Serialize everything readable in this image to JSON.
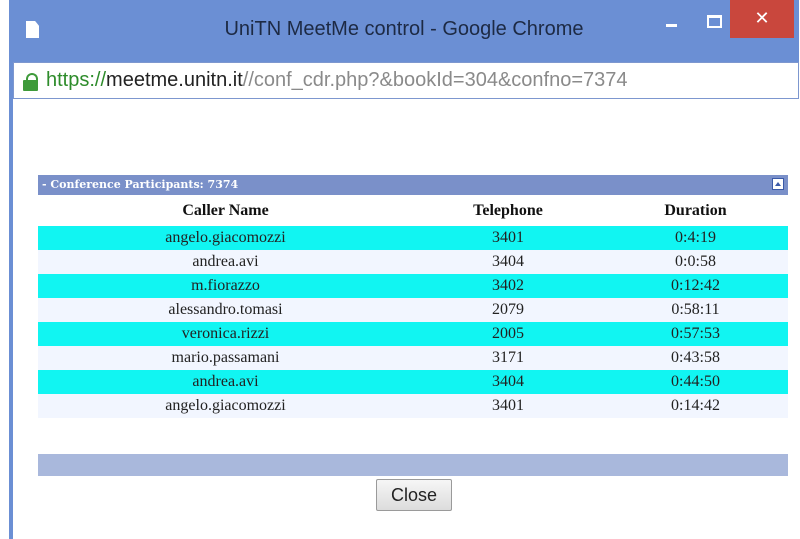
{
  "window": {
    "title": "UniTN MeetMe control - Google Chrome",
    "close_glyph": "✕"
  },
  "addressbar": {
    "scheme": "https://",
    "host": "meetme.unitn.it",
    "path": "//conf_cdr.php?&bookId=304&confno=7374"
  },
  "panel": {
    "title": "- Conference Participants: 7374"
  },
  "table": {
    "headers": [
      "Caller Name",
      "Telephone",
      "Duration"
    ],
    "rows": [
      [
        "angelo.giacomozzi",
        "3401",
        "0:4:19"
      ],
      [
        "andrea.avi",
        "3404",
        "0:0:58"
      ],
      [
        "m.fiorazzo",
        "3402",
        "0:12:42"
      ],
      [
        "alessandro.tomasi",
        "2079",
        "0:58:11"
      ],
      [
        "veronica.rizzi",
        "2005",
        "0:57:53"
      ],
      [
        "mario.passamani",
        "3171",
        "0:43:58"
      ],
      [
        "andrea.avi",
        "3404",
        "0:44:50"
      ],
      [
        "angelo.giacomozzi",
        "3401",
        "0:14:42"
      ]
    ]
  },
  "buttons": {
    "close_label": "Close"
  },
  "colors": {
    "chrome_frame": "#6b8fd4",
    "row_highlight": "#11f5f2",
    "row_alt": "#f2f6ff",
    "panel_header": "#7a90c9",
    "close_button": "#c9473d"
  }
}
